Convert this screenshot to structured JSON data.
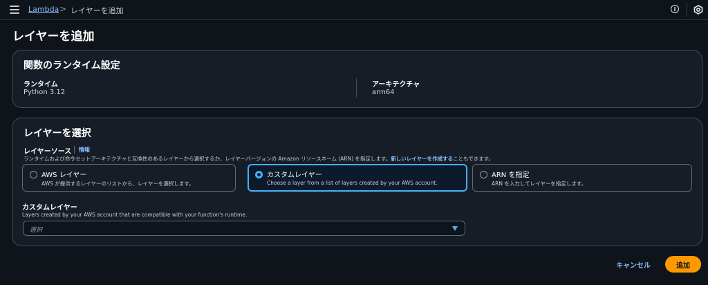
{
  "breadcrumb": {
    "root": "Lambda",
    "separator": ">",
    "current": "レイヤーを追加"
  },
  "topbar": {
    "info_icon_glyph": "i",
    "info_icon": "info-icon",
    "settings_icon": "settings-icon"
  },
  "page": {
    "title": "レイヤーを追加"
  },
  "runtime_settings": {
    "title": "関数のランタイム設定",
    "runtime_label": "ランタイム",
    "runtime_value": "Python 3.12",
    "architecture_label": "アーキテクチャ",
    "architecture_value": "arm64"
  },
  "layer_select": {
    "title": "レイヤーを選択",
    "source_label": "レイヤーソース",
    "info_link": "情報",
    "description_prefix": "ランタイムおよび命令セットアーキテクチャと互換性のあるレイヤーから選択するか、レイヤーバージョンの Amazon リソースネーム (ARN) を指定します。",
    "description_link": "新しいレイヤーを作成する",
    "description_suffix": "こともできます。",
    "options": [
      {
        "title": "AWS レイヤー",
        "description": "AWS が提供するレイヤーのリストから、レイヤーを選択します。",
        "selected": false
      },
      {
        "title": "カスタムレイヤー",
        "description": "Choose a layer from a list of layers created by your AWS account.",
        "selected": true
      },
      {
        "title": "ARN を指定",
        "description": "ARN を入力してレイヤーを指定します。",
        "selected": false
      }
    ],
    "custom_layer_label": "カスタムレイヤー",
    "custom_layer_description": "Layers created by your AWS account that are compatible with your function's runtime.",
    "select_placeholder": "選択"
  },
  "actions": {
    "cancel_label": "キャンセル",
    "add_label": "追加"
  },
  "colors": {
    "background": "#0f141a",
    "card": "#161d26",
    "link": "#89bdff",
    "selected_accent": "#42b4ff",
    "primary_button": "#ff9900"
  }
}
